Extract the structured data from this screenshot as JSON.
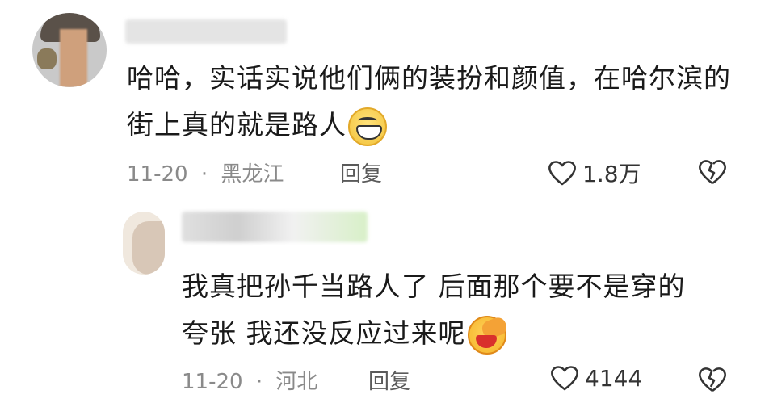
{
  "comment1": {
    "text": "哈哈，实话实说他们俩的装扮和颜值，在哈尔滨的街上真的就是路人",
    "emoji": "grinning-face-emoji",
    "date": "11-20",
    "separator": "·",
    "location": "黑龙江",
    "reply_label": "回复",
    "like_count": "1.8万"
  },
  "comment2": {
    "text_line1": "我真把孙千当路人了 后面那个要不是穿的",
    "text_line2": "夸张 我还没反应过来呢",
    "emoji": "facepalm-emoji",
    "date": "11-20",
    "separator": "·",
    "location": "河北",
    "reply_label": "回复",
    "like_count": "4144"
  }
}
